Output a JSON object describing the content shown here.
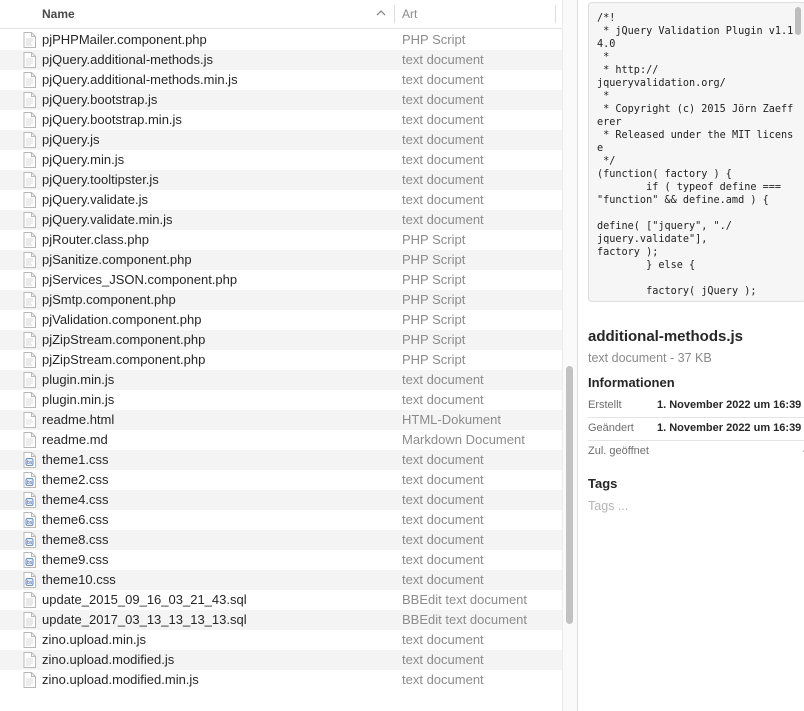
{
  "list": {
    "headers": {
      "name": "Name",
      "kind": "Art"
    },
    "files": [
      {
        "name": "pjPHPMailer.component.php",
        "kind": "PHP Script",
        "icon": "php-file-icon"
      },
      {
        "name": "pjQuery.additional-methods.js",
        "kind": "text document",
        "icon": "text-file-icon"
      },
      {
        "name": "pjQuery.additional-methods.min.js",
        "kind": "text document",
        "icon": "text-file-icon"
      },
      {
        "name": "pjQuery.bootstrap.js",
        "kind": "text document",
        "icon": "text-file-icon"
      },
      {
        "name": "pjQuery.bootstrap.min.js",
        "kind": "text document",
        "icon": "text-file-icon"
      },
      {
        "name": "pjQuery.js",
        "kind": "text document",
        "icon": "text-file-icon"
      },
      {
        "name": "pjQuery.min.js",
        "kind": "text document",
        "icon": "text-file-icon"
      },
      {
        "name": "pjQuery.tooltipster.js",
        "kind": "text document",
        "icon": "text-file-icon"
      },
      {
        "name": "pjQuery.validate.js",
        "kind": "text document",
        "icon": "text-file-icon"
      },
      {
        "name": "pjQuery.validate.min.js",
        "kind": "text document",
        "icon": "text-file-icon"
      },
      {
        "name": "pjRouter.class.php",
        "kind": "PHP Script",
        "icon": "php-file-icon"
      },
      {
        "name": "pjSanitize.component.php",
        "kind": "PHP Script",
        "icon": "php-file-icon"
      },
      {
        "name": "pjServices_JSON.component.php",
        "kind": "PHP Script",
        "icon": "php-file-icon"
      },
      {
        "name": "pjSmtp.component.php",
        "kind": "PHP Script",
        "icon": "php-file-icon"
      },
      {
        "name": "pjValidation.component.php",
        "kind": "PHP Script",
        "icon": "php-file-icon"
      },
      {
        "name": "pjZipStream.component.php",
        "kind": "PHP Script",
        "icon": "php-file-icon"
      },
      {
        "name": "pjZipStream.component.php",
        "kind": "PHP Script",
        "icon": "php-file-icon"
      },
      {
        "name": "plugin.min.js",
        "kind": "text document",
        "icon": "text-file-icon"
      },
      {
        "name": "plugin.min.js",
        "kind": "text document",
        "icon": "text-file-icon"
      },
      {
        "name": "readme.html",
        "kind": "HTML-Dokument",
        "icon": "html-file-icon"
      },
      {
        "name": "readme.md",
        "kind": "Markdown Document",
        "icon": "text-file-icon"
      },
      {
        "name": "theme1.css",
        "kind": "text document",
        "icon": "css-file-icon"
      },
      {
        "name": "theme2.css",
        "kind": "text document",
        "icon": "css-file-icon"
      },
      {
        "name": "theme4.css",
        "kind": "text document",
        "icon": "css-file-icon"
      },
      {
        "name": "theme6.css",
        "kind": "text document",
        "icon": "css-file-icon"
      },
      {
        "name": "theme8.css",
        "kind": "text document",
        "icon": "css-file-icon"
      },
      {
        "name": "theme9.css",
        "kind": "text document",
        "icon": "css-file-icon"
      },
      {
        "name": "theme10.css",
        "kind": "text document",
        "icon": "css-file-icon"
      },
      {
        "name": "update_2015_09_16_03_21_43.sql",
        "kind": "BBEdit text document",
        "icon": "sql-file-icon"
      },
      {
        "name": "update_2017_03_13_13_13_13.sql",
        "kind": "BBEdit text document",
        "icon": "sql-file-icon"
      },
      {
        "name": "zino.upload.min.js",
        "kind": "text document",
        "icon": "text-file-icon"
      },
      {
        "name": "zino.upload.modified.js",
        "kind": "text document",
        "icon": "text-file-icon"
      },
      {
        "name": "zino.upload.modified.min.js",
        "kind": "text document",
        "icon": "text-file-icon"
      }
    ]
  },
  "preview": {
    "code": "/*!\n * jQuery Validation Plugin v1.14.0\n *\n * http://\njqueryvalidation.org/\n *\n * Copyright (c) 2015 Jörn Zaefferer\n * Released under the MIT license\n */\n(function( factory ) {\n        if ( typeof define === \"function\" && define.amd ) {\n\ndefine( [\"jquery\", \"./\njquery.validate\"],\nfactory );\n        } else {\n\n        factory( jQuery );"
  },
  "info": {
    "title": "additional-methods.js",
    "subtitle": "text document - 37 KB",
    "heading": "Informationen",
    "rows": [
      {
        "label": "Erstellt",
        "value": "1. November 2022 um 16:39"
      },
      {
        "label": "Geändert",
        "value": "1. November 2022 um 16:39"
      },
      {
        "label": "Zul. geöffnet",
        "value": "--"
      }
    ],
    "tags_heading": "Tags",
    "tags_placeholder": "Tags ..."
  },
  "colors": {
    "row_alt": "#f4f4f4",
    "kind_text": "#8c8c8c",
    "scroll_thumb": "#c2c2c2",
    "css_icon_accent": "#3d6fd8"
  }
}
